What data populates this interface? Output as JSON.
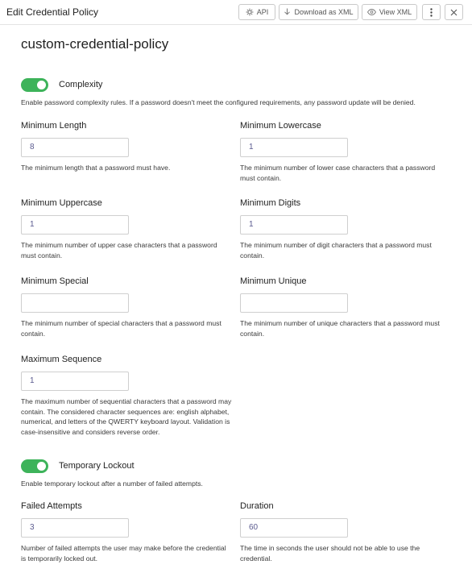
{
  "header": {
    "title": "Edit Credential Policy",
    "api_label": "API",
    "download_label": "Download as XML",
    "view_label": "View XML"
  },
  "policy": {
    "name": "custom-credential-policy"
  },
  "complexity": {
    "label": "Complexity",
    "enabled": true,
    "description": "Enable password complexity rules. If a password doesn't meet the configured requirements, any password update will be denied.",
    "fields": {
      "min_length": {
        "label": "Minimum Length",
        "value": "8",
        "help": "The minimum length that a password must have."
      },
      "min_lowercase": {
        "label": "Minimum Lowercase",
        "value": "1",
        "help": "The minimum number of lower case characters that a password must contain."
      },
      "min_uppercase": {
        "label": "Minimum Uppercase",
        "value": "1",
        "help": "The minimum number of upper case characters that a password must contain."
      },
      "min_digits": {
        "label": "Minimum Digits",
        "value": "1",
        "help": "The minimum number of digit characters that a password must contain."
      },
      "min_special": {
        "label": "Minimum Special",
        "value": "",
        "help": "The minimum number of special characters that a password must contain."
      },
      "min_unique": {
        "label": "Minimum Unique",
        "value": "",
        "help": "The minimum number of unique characters that a password must contain."
      },
      "max_sequence": {
        "label": "Maximum Sequence",
        "value": "1",
        "help": "The maximum number of sequential characters that a password may contain. The considered character sequences are: english alphabet, numerical, and letters of the QWERTY keyboard layout. Validation is case-insensitive and considers reverse order."
      }
    }
  },
  "lockout": {
    "label": "Temporary Lockout",
    "enabled": true,
    "description": "Enable temporary lockout after a number of failed attempts.",
    "fields": {
      "failed_attempts": {
        "label": "Failed Attempts",
        "value": "3",
        "help": "Number of failed attempts the user may make before the credential is temporarily locked out."
      },
      "duration": {
        "label": "Duration",
        "value": "60",
        "help": "The time in seconds the user should not be able to use the credential."
      }
    }
  },
  "colors": {
    "toggle_on": "#3db35a",
    "input_text": "#5b5b8f"
  }
}
